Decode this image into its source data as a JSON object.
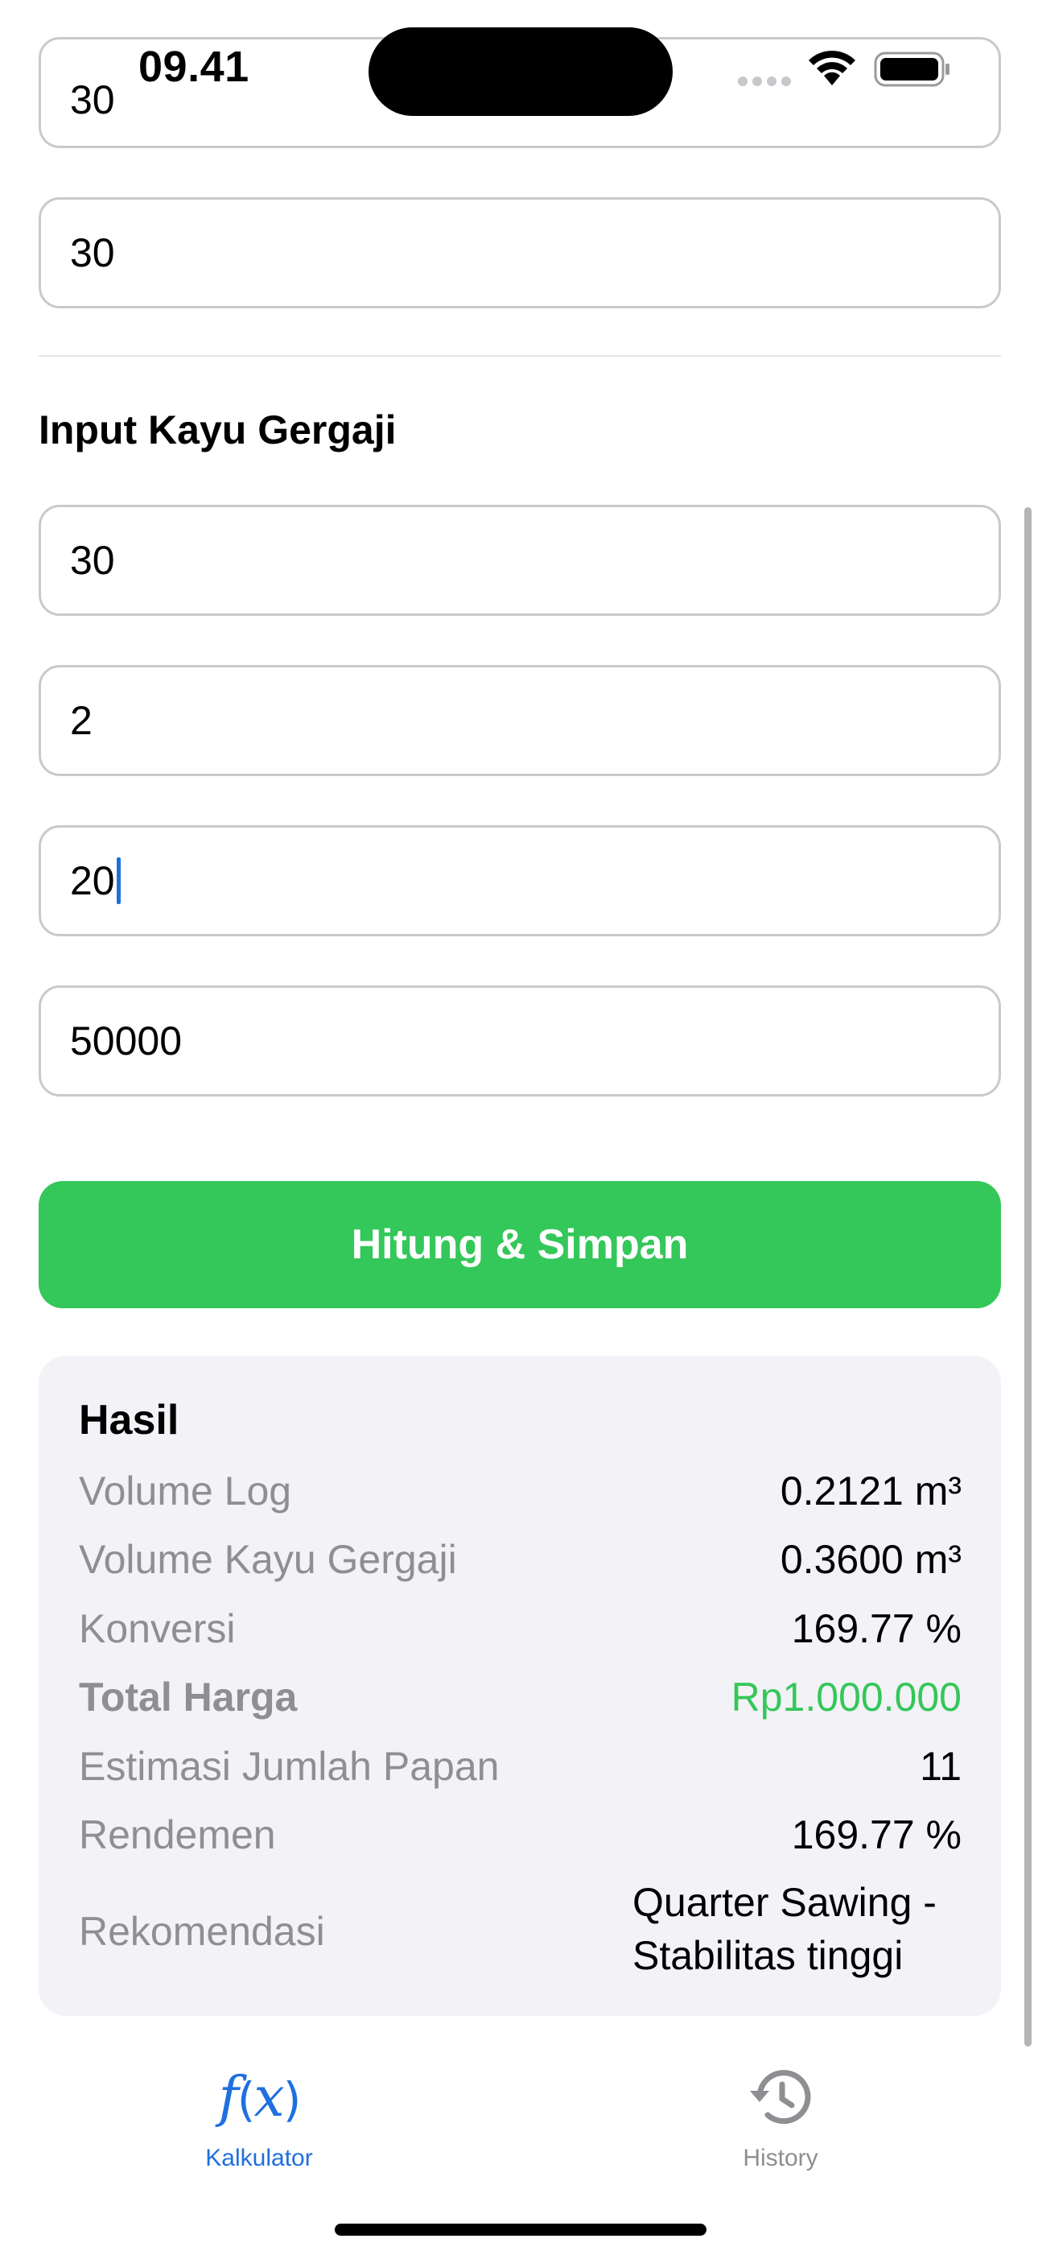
{
  "status_bar": {
    "time": "09.41"
  },
  "top_fields": [
    "30",
    "30"
  ],
  "section": {
    "title": "Input Kayu Gergaji"
  },
  "inputs": [
    "30",
    "2",
    "20",
    "50000"
  ],
  "actions": {
    "calculate_label": "Hitung & Simpan"
  },
  "result": {
    "title": "Hasil",
    "rows": [
      {
        "label": "Volume Log",
        "value": "0.2121 m³"
      },
      {
        "label": "Volume Kayu Gergaji",
        "value": "0.3600 m³"
      },
      {
        "label": "Konversi",
        "value": "169.77 %"
      },
      {
        "label": "Total Harga",
        "value": "Rp1.000.000"
      },
      {
        "label": "Estimasi Jumlah Papan",
        "value": "11"
      },
      {
        "label": "Rendemen",
        "value": "169.77 %"
      }
    ],
    "recommendation": {
      "label": "Rekomendasi",
      "line1": "Quarter Sawing -",
      "line2": "Stabilitas tinggi"
    }
  },
  "tabs": [
    {
      "label": "Kalkulator",
      "icon": "function-fx-icon",
      "active": true
    },
    {
      "label": "History",
      "icon": "history-clock-icon",
      "active": false
    }
  ],
  "colors": {
    "accent": "#1f6fe0",
    "primary_button": "#34c759",
    "price": "#34c759",
    "card_bg": "#f2f2f7"
  }
}
